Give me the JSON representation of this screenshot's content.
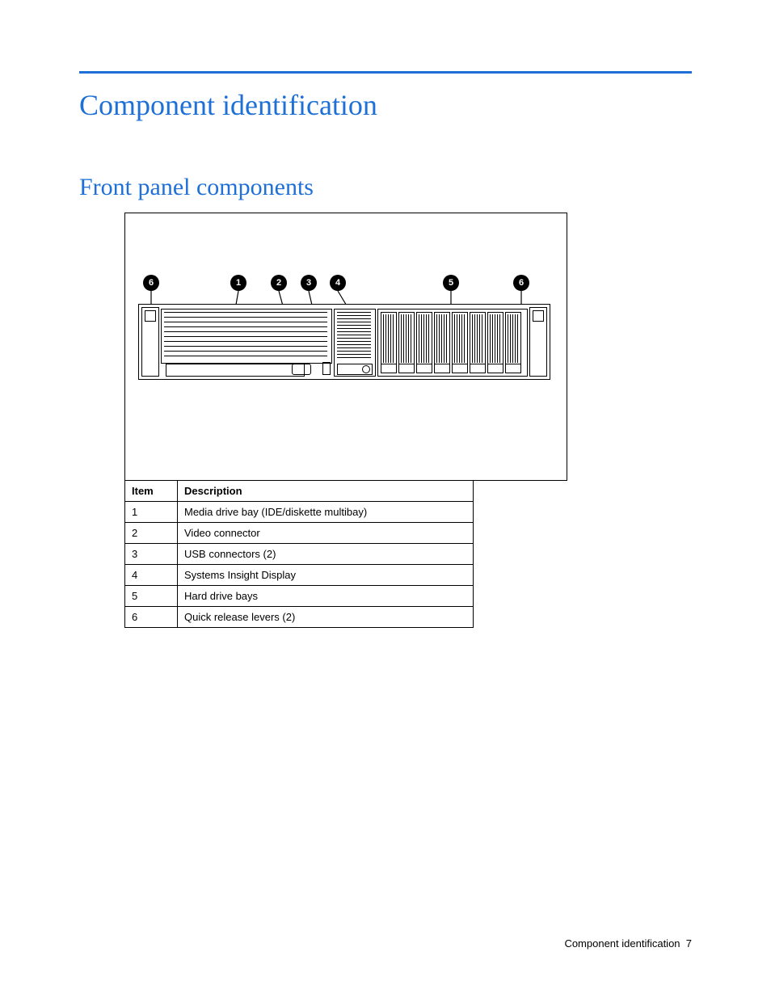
{
  "title": "Component identification",
  "subtitle": "Front panel components",
  "callouts": {
    "c1": "1",
    "c2": "2",
    "c3": "3",
    "c4": "4",
    "c5": "5",
    "c6": "6"
  },
  "table": {
    "headers": {
      "item": "Item",
      "desc": "Description"
    },
    "rows": [
      {
        "item": "1",
        "desc": "Media drive bay (IDE/diskette multibay)"
      },
      {
        "item": "2",
        "desc": "Video connector"
      },
      {
        "item": "3",
        "desc": "USB connectors (2)"
      },
      {
        "item": "4",
        "desc": "Systems Insight Display"
      },
      {
        "item": "5",
        "desc": "Hard drive bays"
      },
      {
        "item": "6",
        "desc": "Quick release levers (2)"
      }
    ]
  },
  "footer": {
    "text": "Component identification",
    "page": "7"
  }
}
